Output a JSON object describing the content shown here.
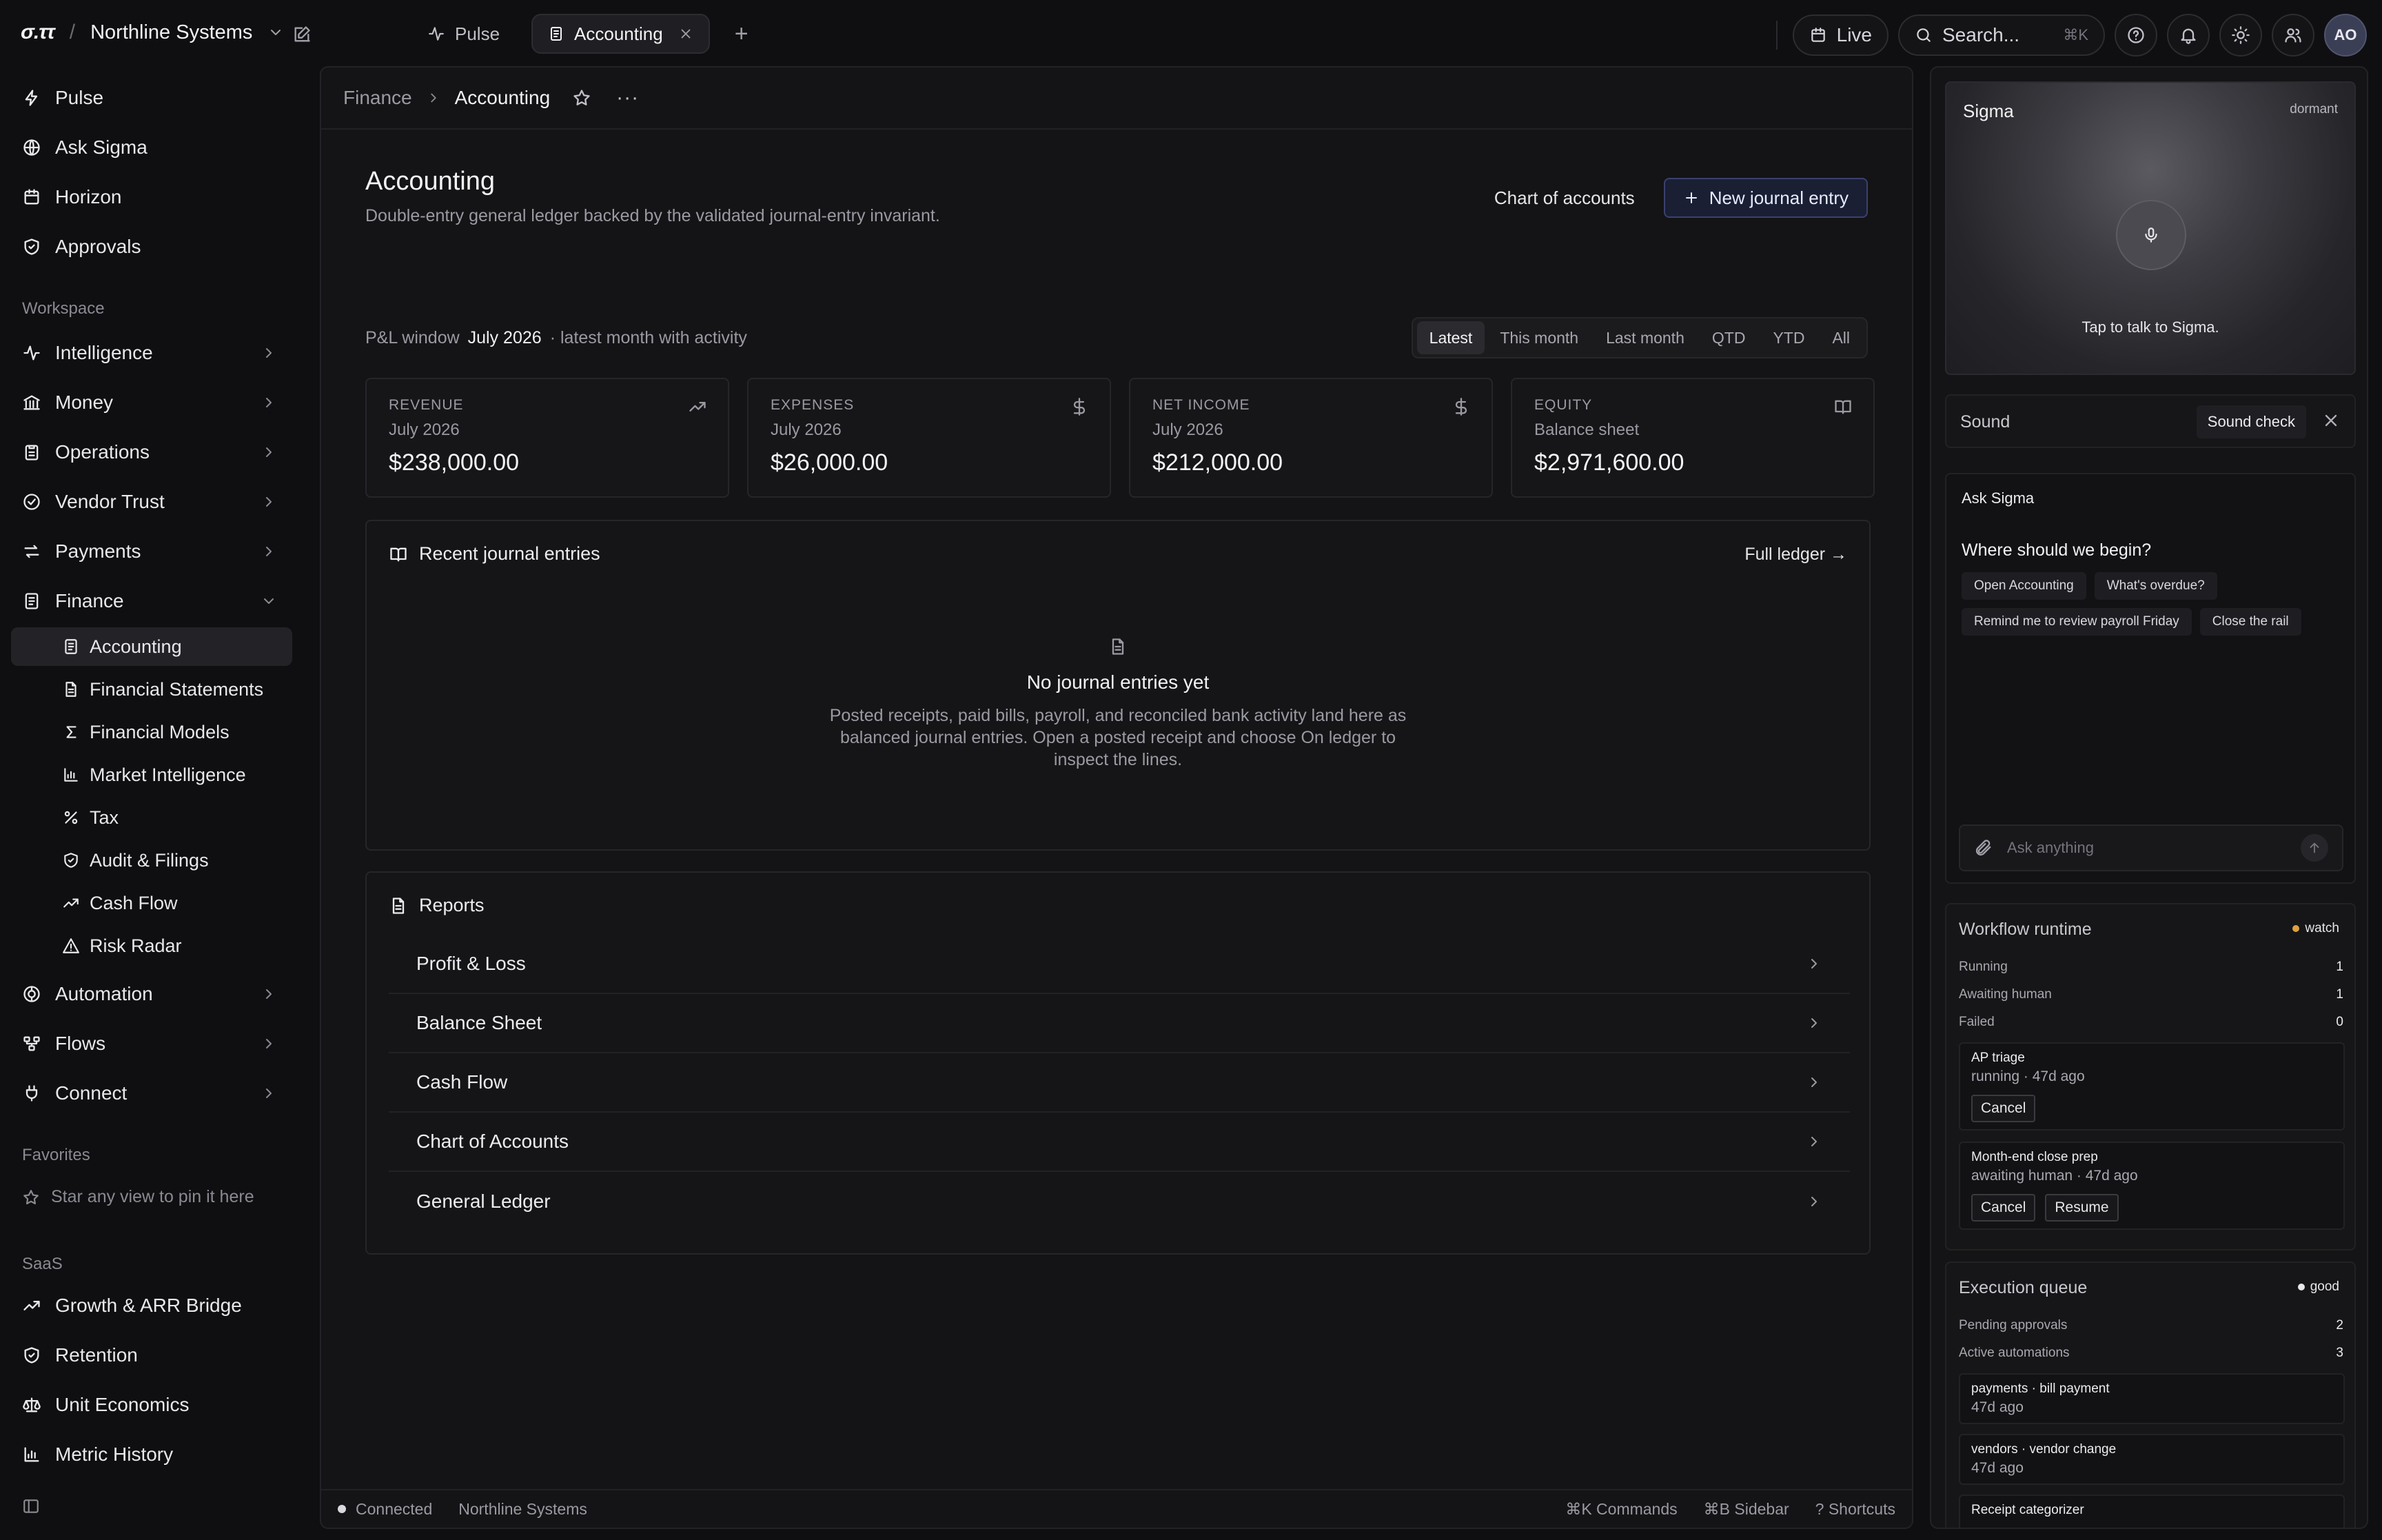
{
  "topbar": {
    "logo": "σ.ττ",
    "org_name": "Northline Systems",
    "tabs": [
      {
        "label": "Pulse",
        "icon": "activity-icon",
        "active": false
      },
      {
        "label": "Accounting",
        "icon": "ledger-icon",
        "active": true
      }
    ],
    "live_label": "Live",
    "search_placeholder": "Search...",
    "search_kbd": "⌘K",
    "avatar_initials": "AO"
  },
  "sidebar": {
    "top_items": [
      "Pulse",
      "Ask Sigma",
      "Horizon",
      "Approvals"
    ],
    "workspace_label": "Workspace",
    "workspace_items": [
      "Intelligence",
      "Money",
      "Operations",
      "Vendor Trust",
      "Payments",
      "Finance"
    ],
    "finance_children": [
      "Accounting",
      "Financial Statements",
      "Financial Models",
      "Market Intelligence",
      "Tax",
      "Audit & Filings",
      "Cash Flow",
      "Risk Radar"
    ],
    "more_items": [
      "Automation",
      "Flows",
      "Connect"
    ],
    "favorites_label": "Favorites",
    "favorites_hint": "Star any view to pin it here",
    "saas_label": "SaaS",
    "saas_items": [
      "Growth & ARR Bridge",
      "Retention",
      "Unit Economics",
      "Metric History"
    ]
  },
  "breadcrumb": {
    "parent": "Finance",
    "current": "Accounting"
  },
  "page": {
    "title": "Accounting",
    "subtitle": "Double-entry general ledger backed by the validated journal-entry invariant.",
    "chart_of_accounts": "Chart of accounts",
    "new_entry": "New journal entry",
    "pl_window_label": "P&L window",
    "pl_window_value": "July 2026",
    "pl_window_note": "· latest month with activity",
    "periods": [
      "Latest",
      "This month",
      "Last month",
      "QTD",
      "YTD",
      "All"
    ],
    "active_period": "Latest"
  },
  "kpis": [
    {
      "label": "REVENUE",
      "period": "July 2026",
      "value": "$238,000.00",
      "icon": "trending-up-icon"
    },
    {
      "label": "EXPENSES",
      "period": "July 2026",
      "value": "$26,000.00",
      "icon": "dollar-icon"
    },
    {
      "label": "NET INCOME",
      "period": "July 2026",
      "value": "$212,000.00",
      "icon": "dollar-icon"
    },
    {
      "label": "EQUITY",
      "period": "Balance sheet",
      "value": "$2,971,600.00",
      "icon": "book-icon"
    }
  ],
  "journal": {
    "title": "Recent journal entries",
    "link": "Full ledger →",
    "empty_title": "No journal entries yet",
    "empty_body": "Posted receipts, paid bills, payroll, and reconciled bank activity land here as balanced journal entries. Open a posted receipt and choose On ledger to inspect the lines."
  },
  "reports": {
    "title": "Reports",
    "items": [
      "Profit & Loss",
      "Balance Sheet",
      "Cash Flow",
      "Chart of Accounts",
      "General Ledger"
    ]
  },
  "statusbar": {
    "connection": "Connected",
    "org": "Northline Systems",
    "commands": "⌘K Commands",
    "sidebar": "⌘B Sidebar",
    "shortcuts": "? Shortcuts"
  },
  "sigma": {
    "title": "Sigma",
    "state": "dormant",
    "cta": "Tap to talk to Sigma."
  },
  "sound": {
    "label": "Sound",
    "button": "Sound check"
  },
  "ask": {
    "title": "Ask Sigma",
    "question": "Where should we begin?",
    "chips": [
      "Open Accounting",
      "What's overdue?",
      "Remind me to review payroll Friday",
      "Close the rail"
    ],
    "placeholder": "Ask anything"
  },
  "workflow": {
    "title": "Workflow runtime",
    "badge": "watch",
    "badge_color": "#e0a040",
    "stats": [
      {
        "label": "Running",
        "value": "1"
      },
      {
        "label": "Awaiting human",
        "value": "1"
      },
      {
        "label": "Failed",
        "value": "0"
      }
    ],
    "items": [
      {
        "title": "AP triage",
        "status": "running · 47d ago",
        "cancel": "Cancel"
      },
      {
        "title": "Month-end close prep",
        "status": "awaiting human · 47d ago",
        "cancel": "Cancel",
        "resume": "Resume"
      }
    ]
  },
  "queue": {
    "title": "Execution queue",
    "badge": "good",
    "badge_color": "#e8e8ec",
    "stats": [
      {
        "label": "Pending approvals",
        "value": "2"
      },
      {
        "label": "Active automations",
        "value": "3"
      }
    ],
    "items": [
      {
        "title": "payments · bill payment",
        "status": "47d ago"
      },
      {
        "title": "vendors · vendor change",
        "status": "47d ago"
      },
      {
        "title": "Receipt categorizer"
      }
    ]
  }
}
